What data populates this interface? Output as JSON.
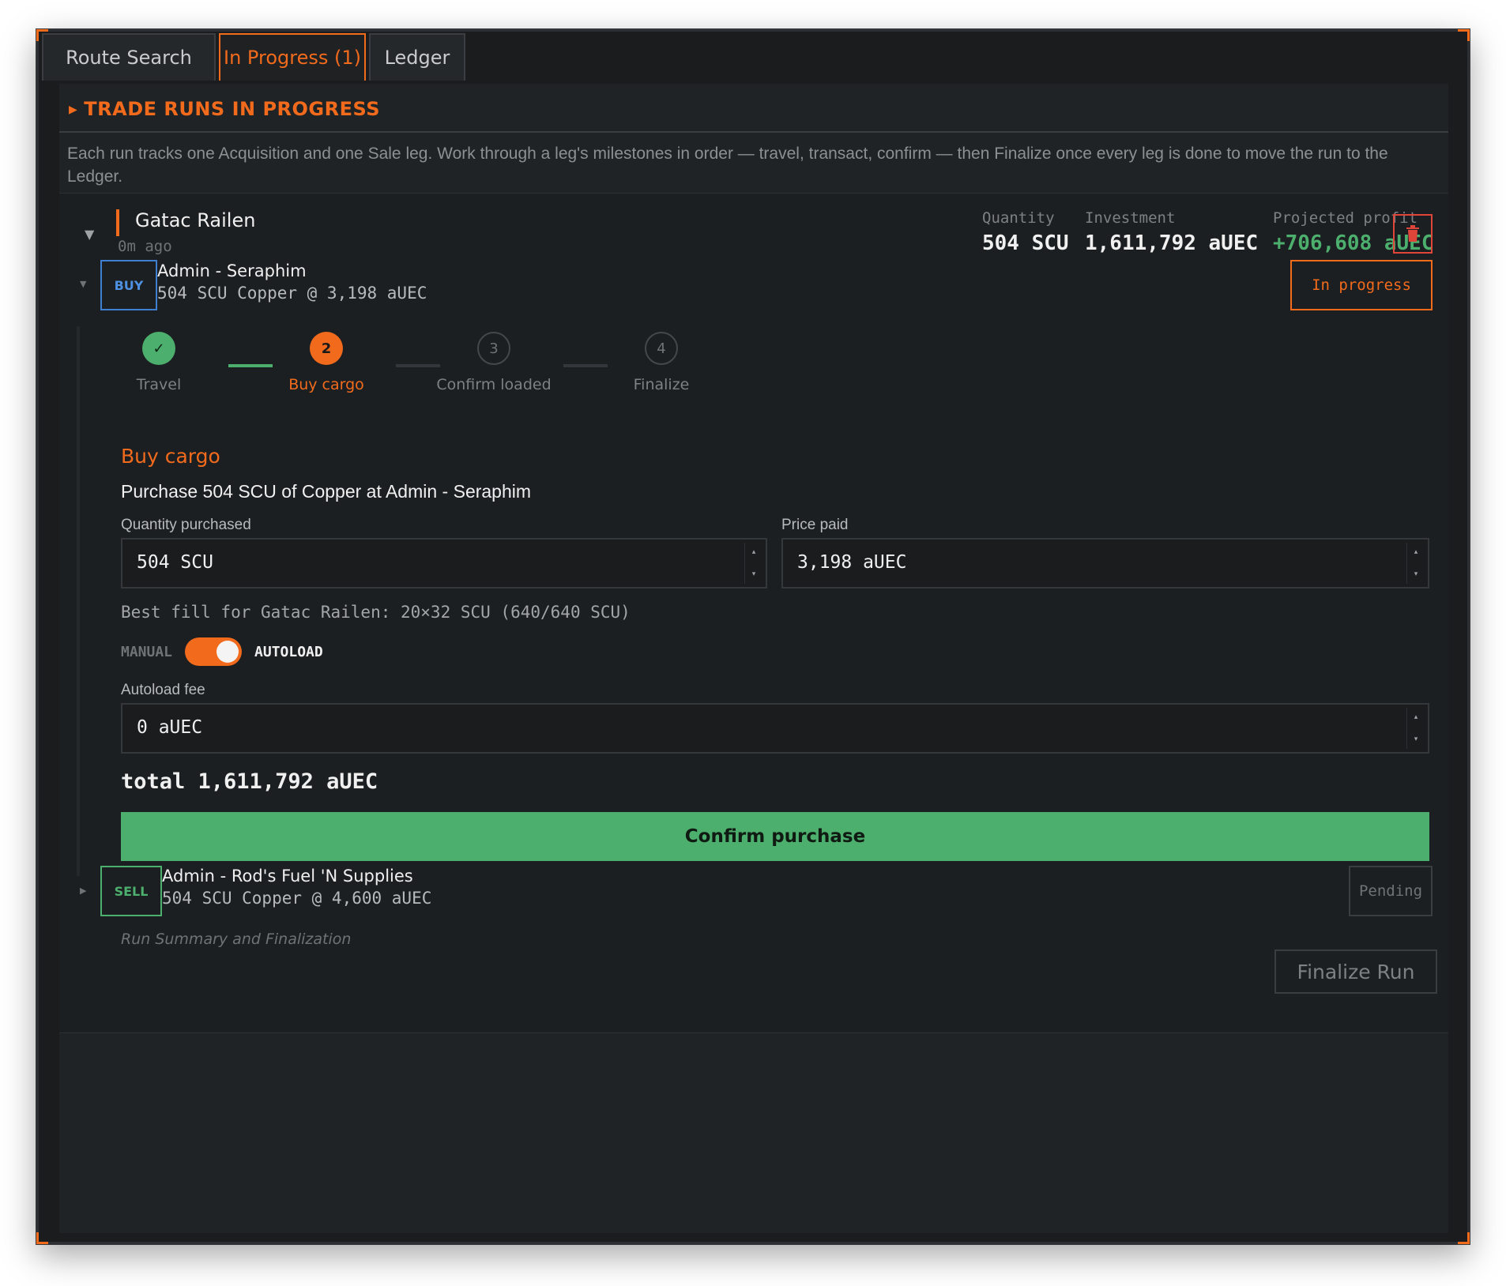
{
  "tabs": [
    {
      "label": "Route Search"
    },
    {
      "label": "In Progress (1)"
    },
    {
      "label": "Ledger"
    }
  ],
  "section": {
    "title": "TRADE RUNS IN PROGRESS",
    "description": "Each run tracks one Acquisition and one Sale leg. Work through a leg's milestones in order — travel, transact, confirm — then Finalize once every leg is done to move the run to the Ledger."
  },
  "run": {
    "ship": "Gatac Railen",
    "age": "0m ago",
    "stats": {
      "quantity_label": "Quantity",
      "quantity_value": "504 SCU",
      "investment_label": "Investment",
      "investment_value": "1,611,792 aUEC",
      "profit_label": "Projected profit",
      "profit_value": "+706,608 aUEC"
    },
    "buy_leg": {
      "badge": "BUY",
      "title": "Admin - Seraphim",
      "subtitle": "504 SCU Copper @ 3,198 aUEC",
      "status": "In progress",
      "steps": [
        {
          "label": "Travel",
          "number": "1",
          "state": "done"
        },
        {
          "label": "Buy cargo",
          "number": "2",
          "state": "current"
        },
        {
          "label": "Confirm loaded",
          "number": "3",
          "state": "todo"
        },
        {
          "label": "Finalize",
          "number": "4",
          "state": "todo"
        }
      ],
      "current_step": {
        "title": "Buy cargo",
        "instruction": "Purchase 504 SCU of Copper at Admin - Seraphim",
        "quantity_label": "Quantity purchased",
        "quantity_value": "504 SCU",
        "price_label": "Price paid",
        "price_value": "3,198 aUEC",
        "best_fill": "Best fill for Gatac Railen: 20×32 SCU (640/640 SCU)",
        "toggle_off_label": "MANUAL",
        "toggle_on_label": "AUTOLOAD",
        "autoload_on": true,
        "fee_label": "Autoload fee",
        "fee_value": "0 aUEC",
        "total": "total 1,611,792 aUEC",
        "confirm_label": "Confirm purchase"
      }
    },
    "sell_leg": {
      "badge": "SELL",
      "title": "Admin - Rod's Fuel 'N Supplies",
      "subtitle": "504 SCU Copper @ 4,600 aUEC",
      "status": "Pending"
    },
    "summary_label": "Run Summary and Finalization",
    "finalize_label": "Finalize Run"
  },
  "colors": {
    "accent": "#f26b1d",
    "success": "#4caf6d",
    "buy": "#4d8fe0",
    "danger": "#e0453a"
  }
}
